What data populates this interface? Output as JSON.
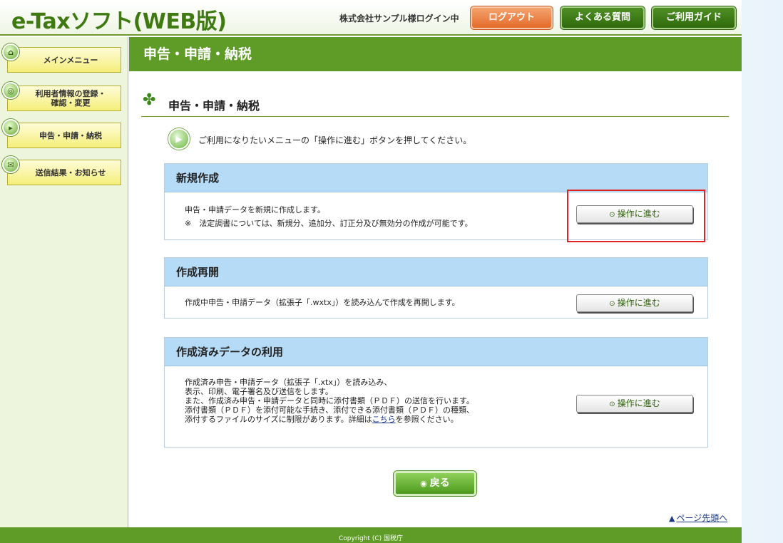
{
  "header": {
    "logo": "e-Taxソフト(WEB版)",
    "login_status": "株式会社サンプル様ログイン中",
    "logout": "ログアウト",
    "faq": "よくある質問",
    "guide": "ご利用ガイド"
  },
  "sidebar": {
    "items": [
      {
        "label": "メインメニュー"
      },
      {
        "label_line1": "利用者情報の登録・",
        "label_line2": "確認・変更"
      },
      {
        "label": "申告・申請・納税"
      },
      {
        "label": "送信結果・お知らせ"
      }
    ]
  },
  "main": {
    "banner_title": "申告・申請・納税",
    "section_title": "申告・申請・納税",
    "instruction": "ご利用になりたいメニューの「操作に進む」ボタンを押してください。",
    "panels": [
      {
        "title": "新規作成",
        "lines": [
          "申告・申請データを新規に作成します。",
          "※　法定調書については、新規分、追加分、訂正分及び無効分の作成が可能です。"
        ],
        "button": "操作に進む"
      },
      {
        "title": "作成再開",
        "lines": [
          "作成中申告・申請データ（拡張子「.wxtx」）を読み込んで作成を再開します。"
        ],
        "button": "操作に進む"
      },
      {
        "title": "作成済みデータの利用",
        "lines": [
          "作成済み申告・申請データ（拡張子「.xtx」）を読み込み、",
          "表示、印刷、電子署名及び送信をします。",
          "また、作成済み申告・申請データと同時に添付書類（ＰＤＦ）の送信を行います。",
          "添付書類（ＰＤＦ）を添付可能な手続き、添付できる添付書類（ＰＤＦ）の種類、",
          "添付するファイルのサイズに制限があります。詳細は"
        ],
        "link": "こちら",
        "link_suffix": "を参照ください。",
        "button": "操作に進む"
      }
    ],
    "back_button": "戻る",
    "page_top": "ページ先頭へ"
  },
  "footer": {
    "copyright": "Copyright (C) 国税庁"
  },
  "colors": {
    "brand_green": "#5e9b27",
    "logout_orange": "#e46a2a",
    "panel_header_blue": "#b5dbf6",
    "highlight_red": "#e32222"
  },
  "icons": {
    "nav_main": "home-icon",
    "nav_user": "user-info-icon",
    "nav_filing": "filing-icon",
    "nav_results": "mail-icon",
    "section": "clover-icon",
    "instruction": "document-arrow-icon",
    "proceed": "play-circle-icon",
    "back": "back-circle-icon",
    "page_top": "up-arrow-icon"
  }
}
